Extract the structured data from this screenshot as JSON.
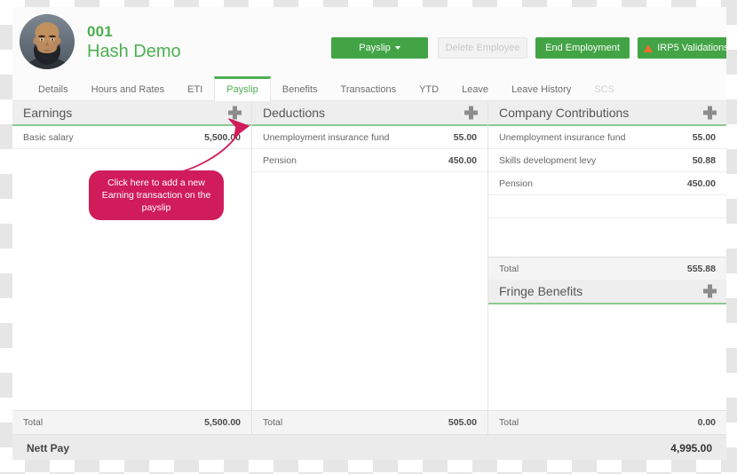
{
  "header": {
    "employee_id": "001",
    "employee_name": "Hash Demo",
    "avatar_icon": "user-photo-avatar",
    "buttons": {
      "payslip": "Payslip",
      "delete_employee": "Delete Employee",
      "end_employment": "End Employment",
      "irp5_validations": "IRP5 Validations"
    },
    "colors": {
      "accent_green": "#4caf50",
      "button_green": "#43a446",
      "warning_orange": "#ef6c2a",
      "callout_pink": "#d01c5b"
    }
  },
  "tabs": [
    {
      "label": "Details",
      "active": false,
      "disabled": false
    },
    {
      "label": "Hours and Rates",
      "active": false,
      "disabled": false
    },
    {
      "label": "ETI",
      "active": false,
      "disabled": false
    },
    {
      "label": "Payslip",
      "active": true,
      "disabled": false
    },
    {
      "label": "Benefits",
      "active": false,
      "disabled": false
    },
    {
      "label": "Transactions",
      "active": false,
      "disabled": false
    },
    {
      "label": "YTD",
      "active": false,
      "disabled": false
    },
    {
      "label": "Leave",
      "active": false,
      "disabled": false
    },
    {
      "label": "Leave History",
      "active": false,
      "disabled": false
    },
    {
      "label": "SCS",
      "active": false,
      "disabled": true
    }
  ],
  "earnings": {
    "title": "Earnings",
    "add_icon": "plus-icon",
    "rows": [
      {
        "label": "Basic salary",
        "amount": "5,500.00"
      }
    ],
    "total_label": "Total",
    "total_amount": "5,500.00"
  },
  "deductions": {
    "title": "Deductions",
    "add_icon": "plus-icon",
    "rows": [
      {
        "label": "Unemployment insurance fund",
        "amount": "55.00"
      },
      {
        "label": "Pension",
        "amount": "450.00"
      }
    ],
    "total_label": "Total",
    "total_amount": "505.00"
  },
  "company_contributions": {
    "title": "Company Contributions",
    "add_icon": "plus-icon",
    "rows": [
      {
        "label": "Unemployment insurance fund",
        "amount": "55.00"
      },
      {
        "label": "Skills development levy",
        "amount": "50.88"
      },
      {
        "label": "Pension",
        "amount": "450.00"
      }
    ],
    "total_label": "Total",
    "total_amount": "555.88"
  },
  "fringe_benefits": {
    "title": "Fringe Benefits",
    "add_icon": "plus-icon",
    "rows": [],
    "total_label": "Total",
    "total_amount": "0.00"
  },
  "nett_pay": {
    "label": "Nett Pay",
    "amount": "4,995.00"
  },
  "callout": {
    "text": "Click here to add a new Earning transaction on the payslip",
    "arrow_icon": "curved-arrow-icon"
  }
}
